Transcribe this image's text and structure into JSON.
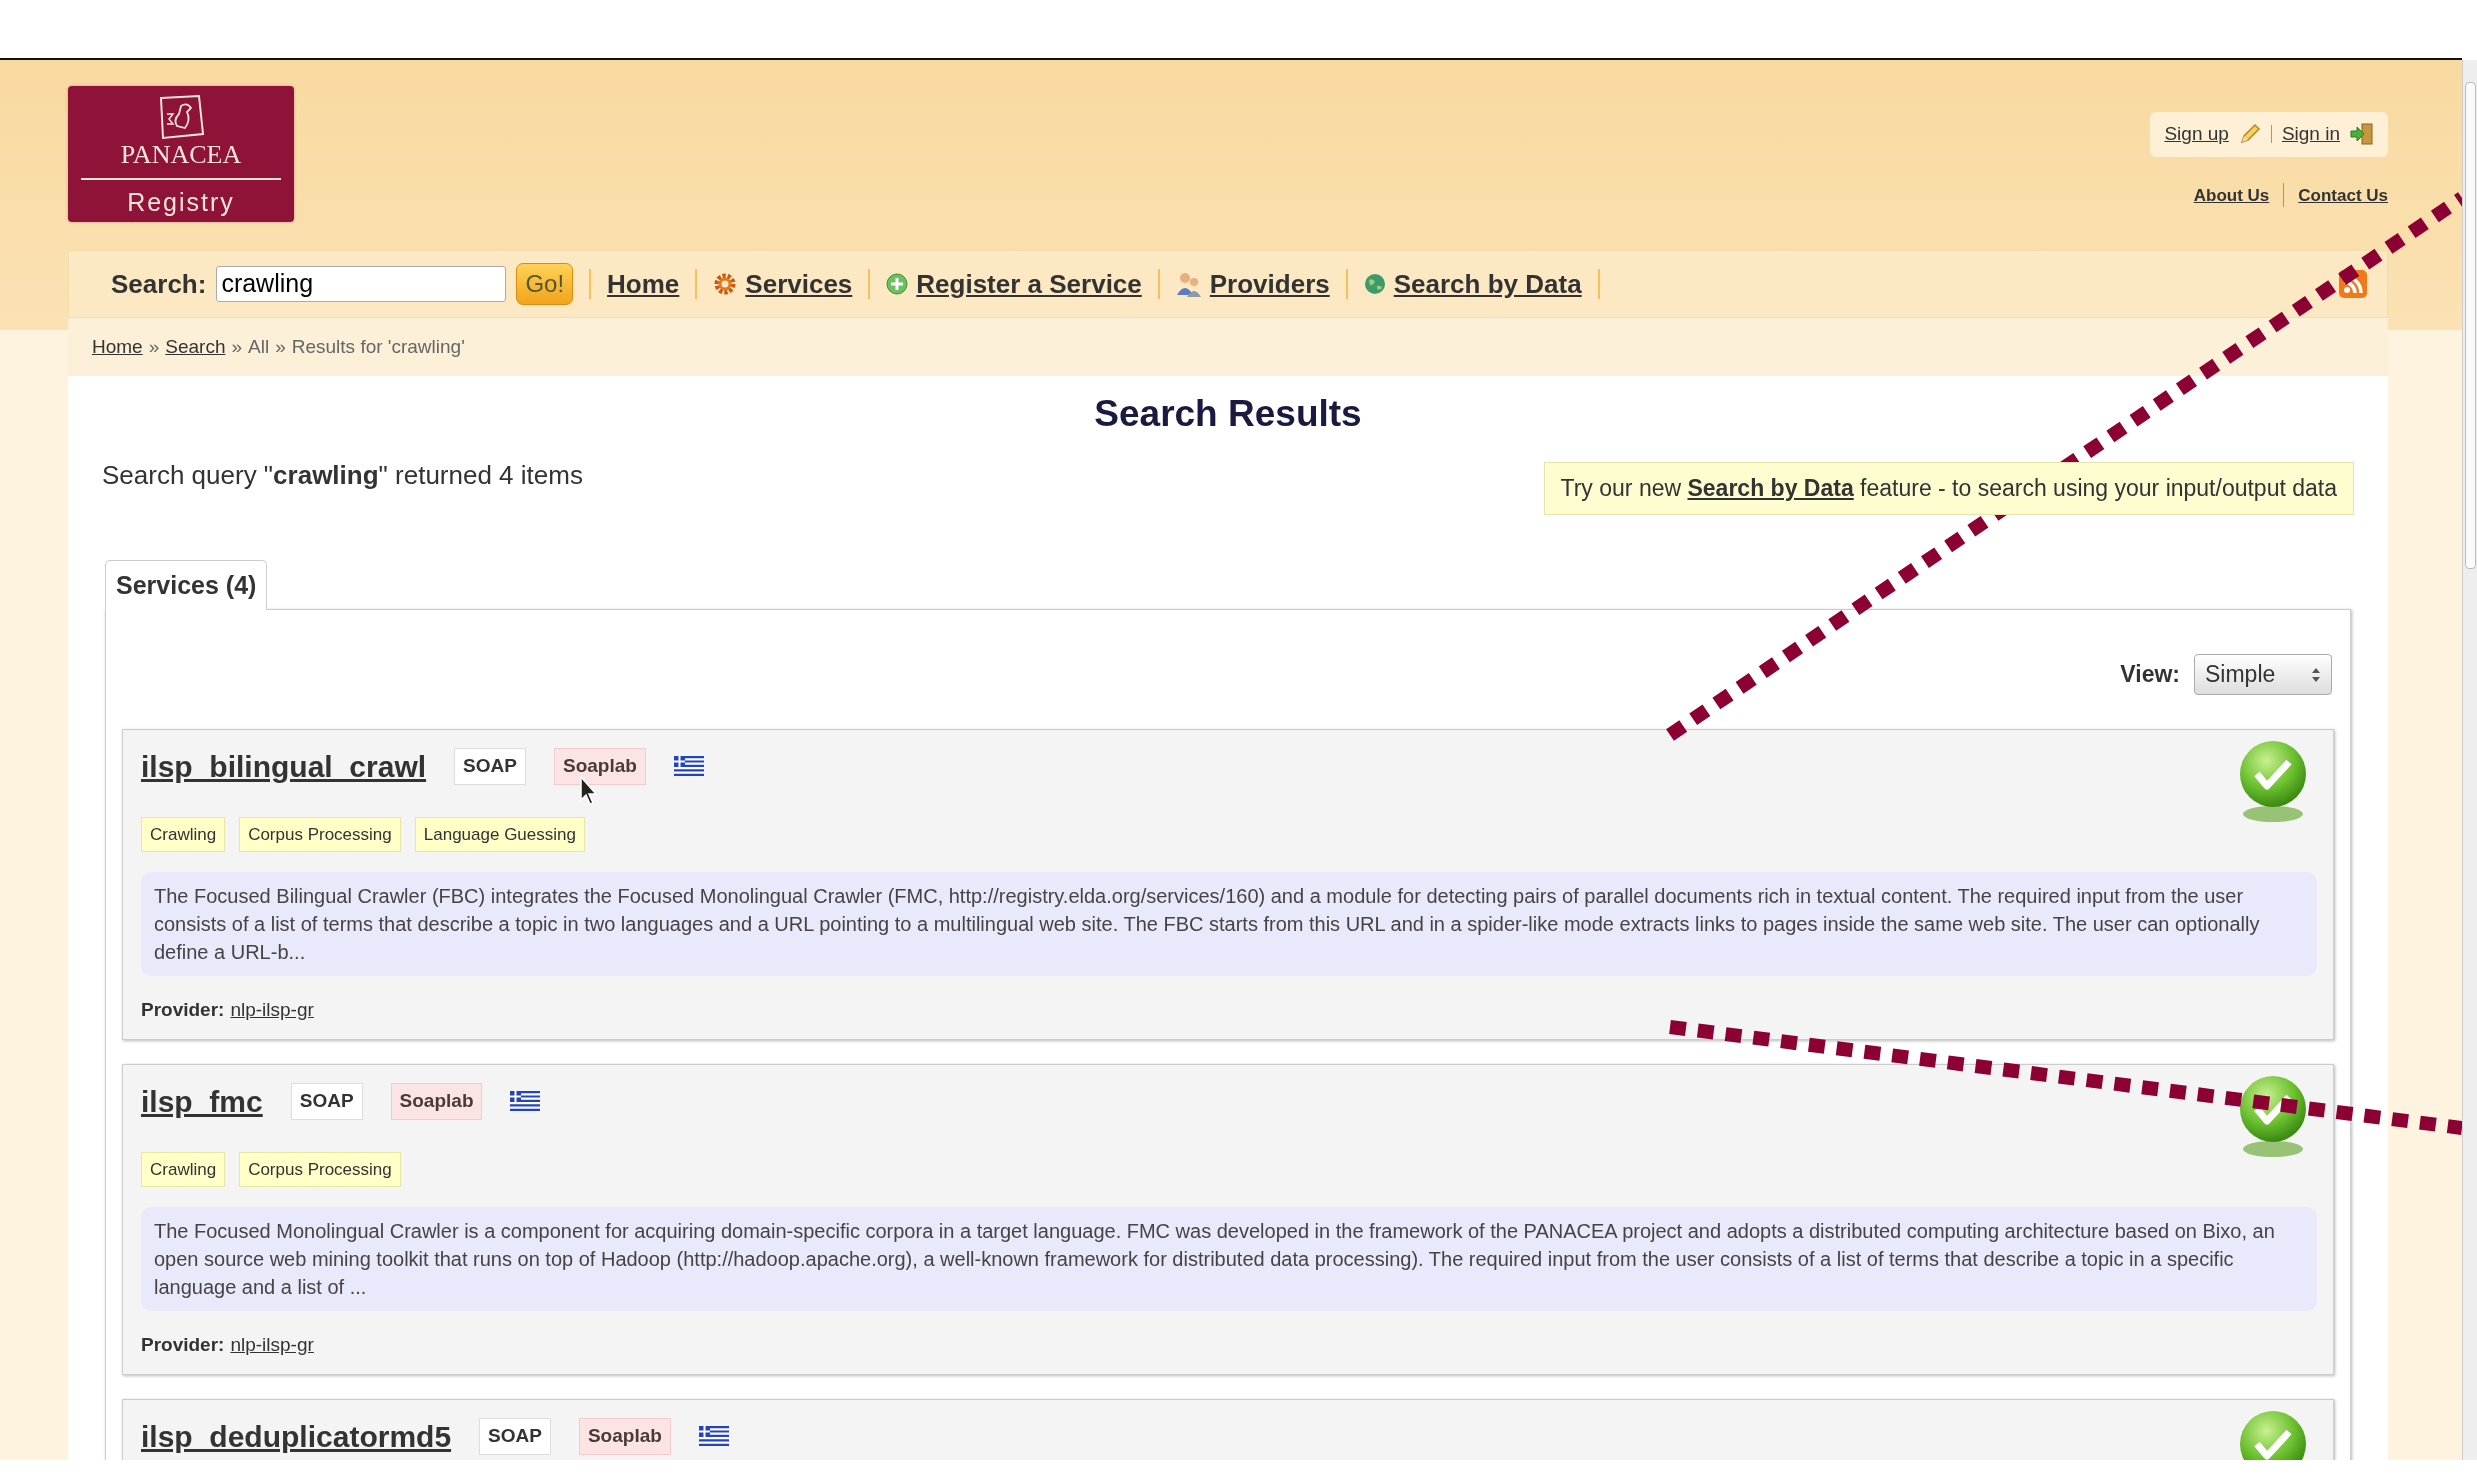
{
  "header": {
    "logo": {
      "title": "PANACEA",
      "subtitle": "Registry"
    },
    "account_links": [
      "Sign up",
      "Sign in"
    ],
    "info_links": [
      "About Us",
      "Contact Us"
    ]
  },
  "search": {
    "label": "Search:",
    "value": "crawling",
    "button": "Go!"
  },
  "nav": [
    {
      "label": "Home"
    },
    {
      "label": "Services"
    },
    {
      "label": "Register a Service"
    },
    {
      "label": "Providers"
    },
    {
      "label": "Search by Data"
    }
  ],
  "breadcrumb": [
    {
      "text": "Home",
      "link": true
    },
    {
      "text": "»",
      "link": false
    },
    {
      "text": "Search",
      "link": true
    },
    {
      "text": "»",
      "link": false
    },
    {
      "text": "All",
      "link": false
    },
    {
      "text": "»",
      "link": false
    },
    {
      "text": "Results for 'crawling'",
      "link": false
    }
  ],
  "page_title": "Search Results",
  "summary": "Search query \"**crawling**\" returned 4 items",
  "tip": {
    "before": "Try our new",
    "link": "Search by Data",
    "after": "feature - to search using your input/output data"
  },
  "tabs": [
    {
      "label": "Services (4)",
      "selected": true
    }
  ],
  "view": {
    "label": "View:",
    "value": "Simple"
  },
  "services": [
    {
      "name": "ilsp_bilingual_crawl",
      "badges": [
        {
          "text": "SOAP",
          "kind": "protocol"
        },
        {
          "text": "Soaplab",
          "kind": "framework"
        }
      ],
      "tags": [
        "Crawling",
        "Corpus Processing",
        "Language Guessing"
      ],
      "description": "The Focused Bilingual Crawler (FBC) integrates the Focused Monolingual Crawler (FMC, http://registry.elda.org/services/160) and a module for detecting pairs of parallel documents rich in textual content. The required input from the user consists of a list of terms that describe a topic in two languages and a URL pointing to a multilingual web site. The FBC starts from this URL and in a spider-like mode extracts links to pages inside the same web site. The user can optionally define a URL-b...",
      "provider_label": "Provider:",
      "provider": "nlp-ilsp-gr"
    },
    {
      "name": "ilsp_fmc",
      "badges": [
        {
          "text": "SOAP",
          "kind": "protocol"
        },
        {
          "text": "Soaplab",
          "kind": "framework"
        }
      ],
      "tags": [
        "Crawling",
        "Corpus Processing"
      ],
      "description": "The Focused Monolingual Crawler is a component for acquiring domain-specific corpora in a target language. FMC was developed in the framework of the PANACEA project and adopts a distributed computing architecture based on Bixo, an open source web mining toolkit that runs on top of Hadoop (http://hadoop.apache.org), a well-known framework for distributed data processing). The required input from the user consists of a list of terms that describe a topic in a specific language and a list of ...",
      "provider_label": "Provider:",
      "provider": "nlp-ilsp-gr"
    },
    {
      "name": "ilsp_deduplicatormd5",
      "badges": [
        {
          "text": "SOAP",
          "kind": "protocol"
        },
        {
          "text": "Soaplab",
          "kind": "framework"
        }
      ]
    }
  ]
}
